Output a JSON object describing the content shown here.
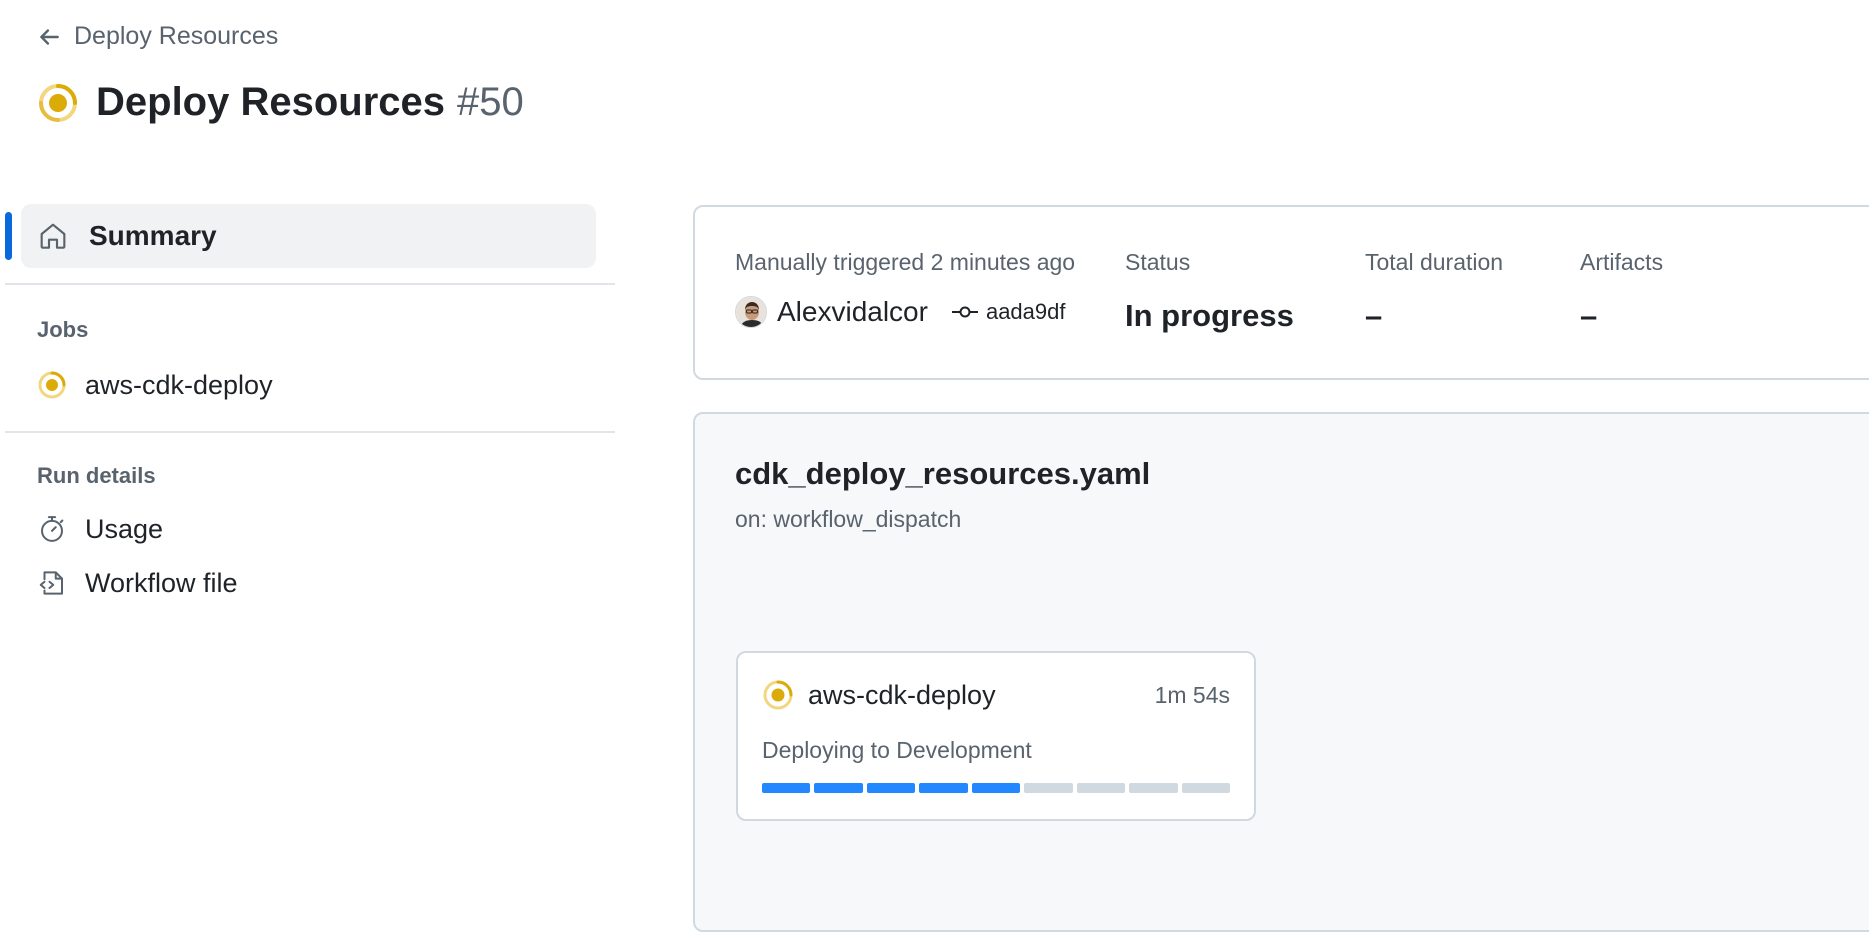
{
  "header": {
    "back_label": "Deploy Resources",
    "title": "Deploy Resources",
    "run_number": "#50",
    "status": "in_progress"
  },
  "sidebar": {
    "summary_label": "Summary",
    "jobs_heading": "Jobs",
    "jobs": [
      {
        "label": "aws-cdk-deploy",
        "status": "in_progress"
      }
    ],
    "run_details_heading": "Run details",
    "run_details": [
      {
        "label": "Usage",
        "icon": "stopwatch-icon"
      },
      {
        "label": "Workflow file",
        "icon": "file-code-icon"
      }
    ]
  },
  "summary": {
    "trigger_text": "Manually triggered 2 minutes ago",
    "actor": "Alexvidalcor",
    "commit": "aada9df",
    "status_label": "Status",
    "status_value": "In progress",
    "duration_label": "Total duration",
    "duration_value": "–",
    "artifacts_label": "Artifacts",
    "artifacts_value": "–"
  },
  "workflow": {
    "filename": "cdk_deploy_resources.yaml",
    "trigger": "on: workflow_dispatch",
    "job": {
      "name": "aws-cdk-deploy",
      "duration": "1m 54s",
      "current_step": "Deploying to Development",
      "progress_done": 5,
      "progress_total": 9
    }
  },
  "colors": {
    "accent": "#0969da",
    "in_progress": "#dbab0a",
    "progress_fill": "#2188ff",
    "progress_empty": "#d1d9e0"
  }
}
